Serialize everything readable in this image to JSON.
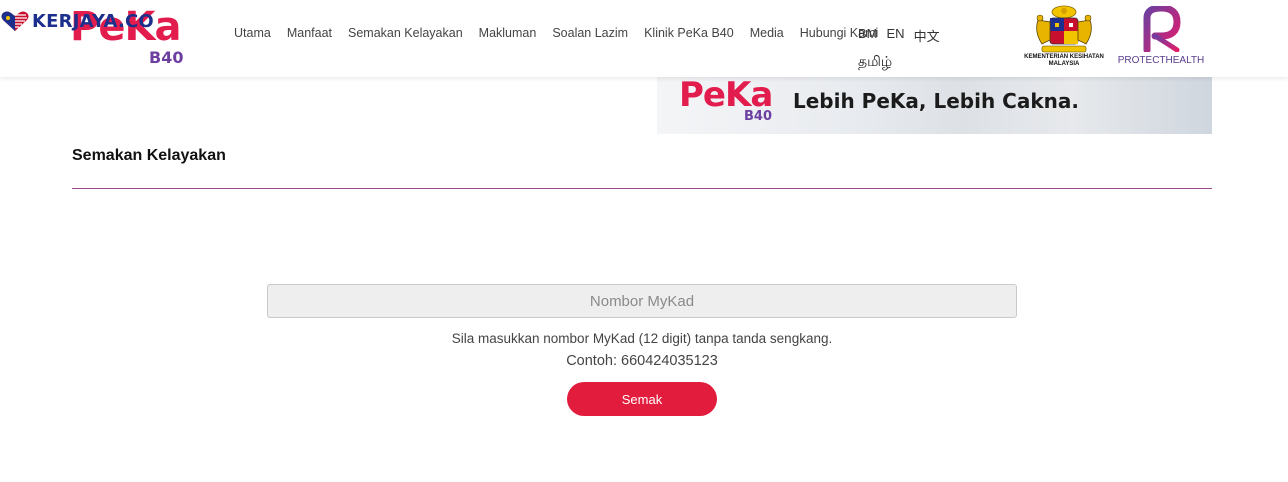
{
  "watermark": {
    "text": "KERJAYA.CO"
  },
  "logo": {
    "main": "PeKa",
    "sub": "B40"
  },
  "nav": {
    "items": [
      {
        "label": "Utama"
      },
      {
        "label": "Manfaat"
      },
      {
        "label": "Semakan Kelayakan"
      },
      {
        "label": "Makluman"
      },
      {
        "label": "Soalan Lazim"
      },
      {
        "label": "Klinik PeKa B40"
      },
      {
        "label": "Media"
      },
      {
        "label": "Hubungi Kami"
      }
    ]
  },
  "languages": {
    "bm": "BM",
    "en": "EN",
    "zh": "中文",
    "ta": "தமிழ்"
  },
  "partners": {
    "kkm": "KEMENTERIAN KESIHATAN MALAYSIA",
    "protecthealth": "PROTECTHEALTH"
  },
  "banner": {
    "logo_main": "PeKa",
    "logo_sub": "B40",
    "tagline": "Lebih PeKa, Lebih Cakna."
  },
  "page": {
    "title": "Semakan Kelayakan"
  },
  "form": {
    "mykad_placeholder": "Nombor MyKad",
    "mykad_value": "",
    "hint": "Sila masukkan nombor MyKad (12 digit) tanpa tanda sengkang.",
    "example": "Contoh: 660424035123",
    "submit_label": "Semak"
  },
  "colors": {
    "brand_red": "#e21c3d",
    "brand_purple": "#6c3fa0",
    "divider": "#9b4a8e"
  }
}
